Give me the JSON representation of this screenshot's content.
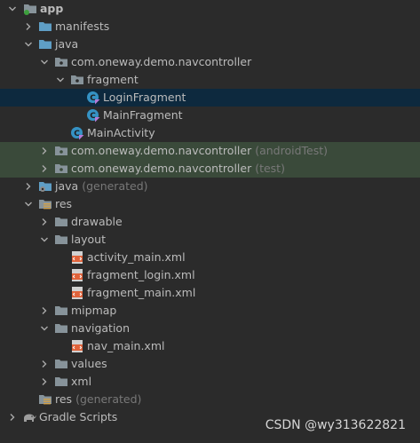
{
  "tree": [
    {
      "name": "app",
      "kind": "module",
      "bold": true
    },
    {
      "name": "manifests",
      "kind": "folder-blue"
    },
    {
      "name": "java",
      "kind": "folder-blue"
    },
    {
      "name": "com.oneway.demo.navcontroller",
      "kind": "package"
    },
    {
      "name": "fragment",
      "kind": "package"
    },
    {
      "name": "LoginFragment",
      "kind": "kotlin-class"
    },
    {
      "name": "MainFragment",
      "kind": "kotlin-class"
    },
    {
      "name": "MainActivity",
      "kind": "kotlin-class"
    },
    {
      "name": "com.oneway.demo.navcontroller",
      "suffix": "(androidTest)",
      "kind": "package"
    },
    {
      "name": "com.oneway.demo.navcontroller",
      "suffix": "(test)",
      "kind": "package"
    },
    {
      "name": "java",
      "suffix": "(generated)",
      "kind": "folder-generated"
    },
    {
      "name": "res",
      "kind": "folder-res"
    },
    {
      "name": "drawable",
      "kind": "folder"
    },
    {
      "name": "layout",
      "kind": "folder"
    },
    {
      "name": "activity_main.xml",
      "kind": "xml"
    },
    {
      "name": "fragment_login.xml",
      "kind": "xml"
    },
    {
      "name": "fragment_main.xml",
      "kind": "xml"
    },
    {
      "name": "mipmap",
      "kind": "folder"
    },
    {
      "name": "navigation",
      "kind": "folder"
    },
    {
      "name": "nav_main.xml",
      "kind": "xml"
    },
    {
      "name": "values",
      "kind": "folder"
    },
    {
      "name": "xml",
      "kind": "folder"
    },
    {
      "name": "res",
      "suffix": "(generated)",
      "kind": "folder-res"
    },
    {
      "name": "Gradle Scripts",
      "kind": "gradle"
    }
  ],
  "watermark": "CSDN @wy313622821"
}
